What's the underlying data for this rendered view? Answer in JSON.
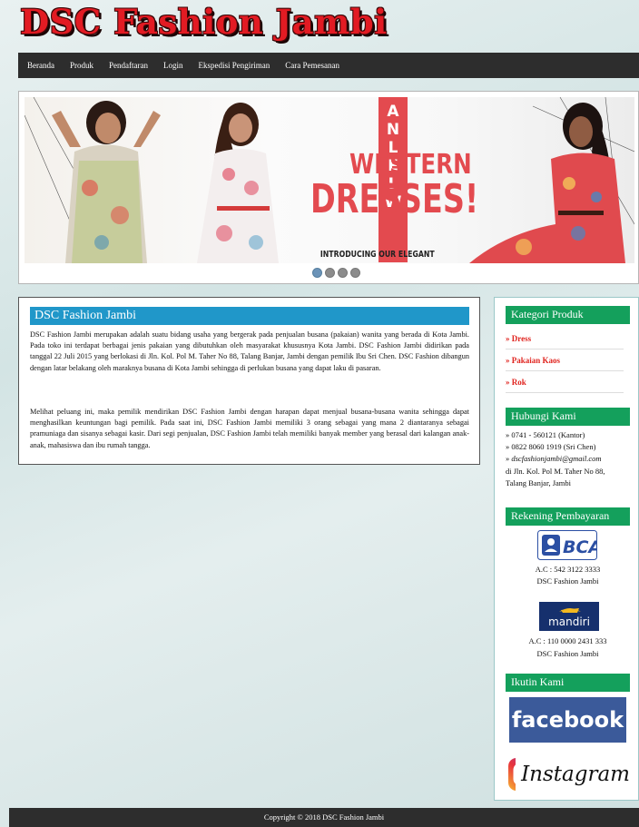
{
  "header": {
    "site_title": "DSC Fashion Jambi"
  },
  "nav": {
    "items": [
      {
        "label": "Beranda"
      },
      {
        "label": "Produk"
      },
      {
        "label": "Pendaftaran"
      },
      {
        "label": "Login"
      },
      {
        "label": "Ekspedisi Pengiriman"
      },
      {
        "label": "Cara Pemesanan"
      }
    ]
  },
  "slider": {
    "banner_letters": [
      "A",
      "N",
      "L",
      "E",
      "L",
      "W"
    ],
    "headline_1": "WESTERN",
    "headline_2": "DRESSES!",
    "tagline": "INTRODUCING OUR ELEGANT",
    "dots": 4,
    "active_dot": 0,
    "accent_color": "#e34a4f"
  },
  "main": {
    "title": "DSC Fashion Jambi",
    "paragraph_1": "DSC Fashion Jambi merupakan adalah suatu bidang usaha yang bergerak pada penjualan busana (pakaian) wanita yang berada di Kota Jambi. Pada toko ini terdapat berbagai jenis pakaian yang dibutuhkan oleh masyarakat khususnya Kota Jambi. DSC Fashion Jambi didirikan pada tanggal 22 Juli 2015 yang berlokasi di Jln. Kol. Pol M. Taher No 88, Talang Banjar, Jambi dengan pemilik Ibu Sri Chen. DSC Fashion dibangun dengan latar belakang oleh maraknya busana di Kota Jambi sehingga di perlukan busana yang dapat laku di pasaran.",
    "paragraph_2": "Melihat peluang ini, maka pemilik mendirikan DSC Fashion Jambi dengan harapan dapat menjual busana-busana wanita sehingga dapat menghasilkan keuntungan bagi pemilik. Pada saat ini, DSC Fashion Jambi memiliki 3 orang sebagai yang mana 2 diantaranya sebagai pramuniaga dan sisanya sebagai kasir. Dari segi penjualan, DSC Fashion Jambi telah memiliki banyak member yang berasal dari kalangan anak-anak, mahasiswa dan ibu rumah tangga."
  },
  "sidebar": {
    "categories_heading": "Kategori Produk",
    "categories": [
      "» Dress",
      "» Pakaian Kaos",
      "» Rok"
    ],
    "contact_heading": "Hubungi Kami",
    "contact_phone_1": "» 0741 - 560121 (Kantor)",
    "contact_phone_2": "» 0822 8060 1919 (Sri Chen)",
    "contact_email_prefix": "» ",
    "contact_email": "dscfashionjambi@gmail.com",
    "contact_address_1": "di Jln. Kol. Pol M. Taher No 88,",
    "contact_address_2": "Talang Banjar, Jambi",
    "payment_heading": "Rekening Pembayaran",
    "bca_logo_text": "BCA",
    "bca_account": "A.C : 542 3122 3333",
    "bca_name": "DSC Fashion Jambi",
    "mandiri_logo_text": "mandiri",
    "mandiri_account": "A.C : 110 0000 2431 333",
    "mandiri_name": "DSC Fashion Jambi",
    "follow_heading": "Ikutin Kami",
    "facebook_label": "facebook",
    "instagram_label": "Instagram"
  },
  "footer": {
    "copyright": "Copyright © 2018 DSC Fashion Jambi"
  }
}
